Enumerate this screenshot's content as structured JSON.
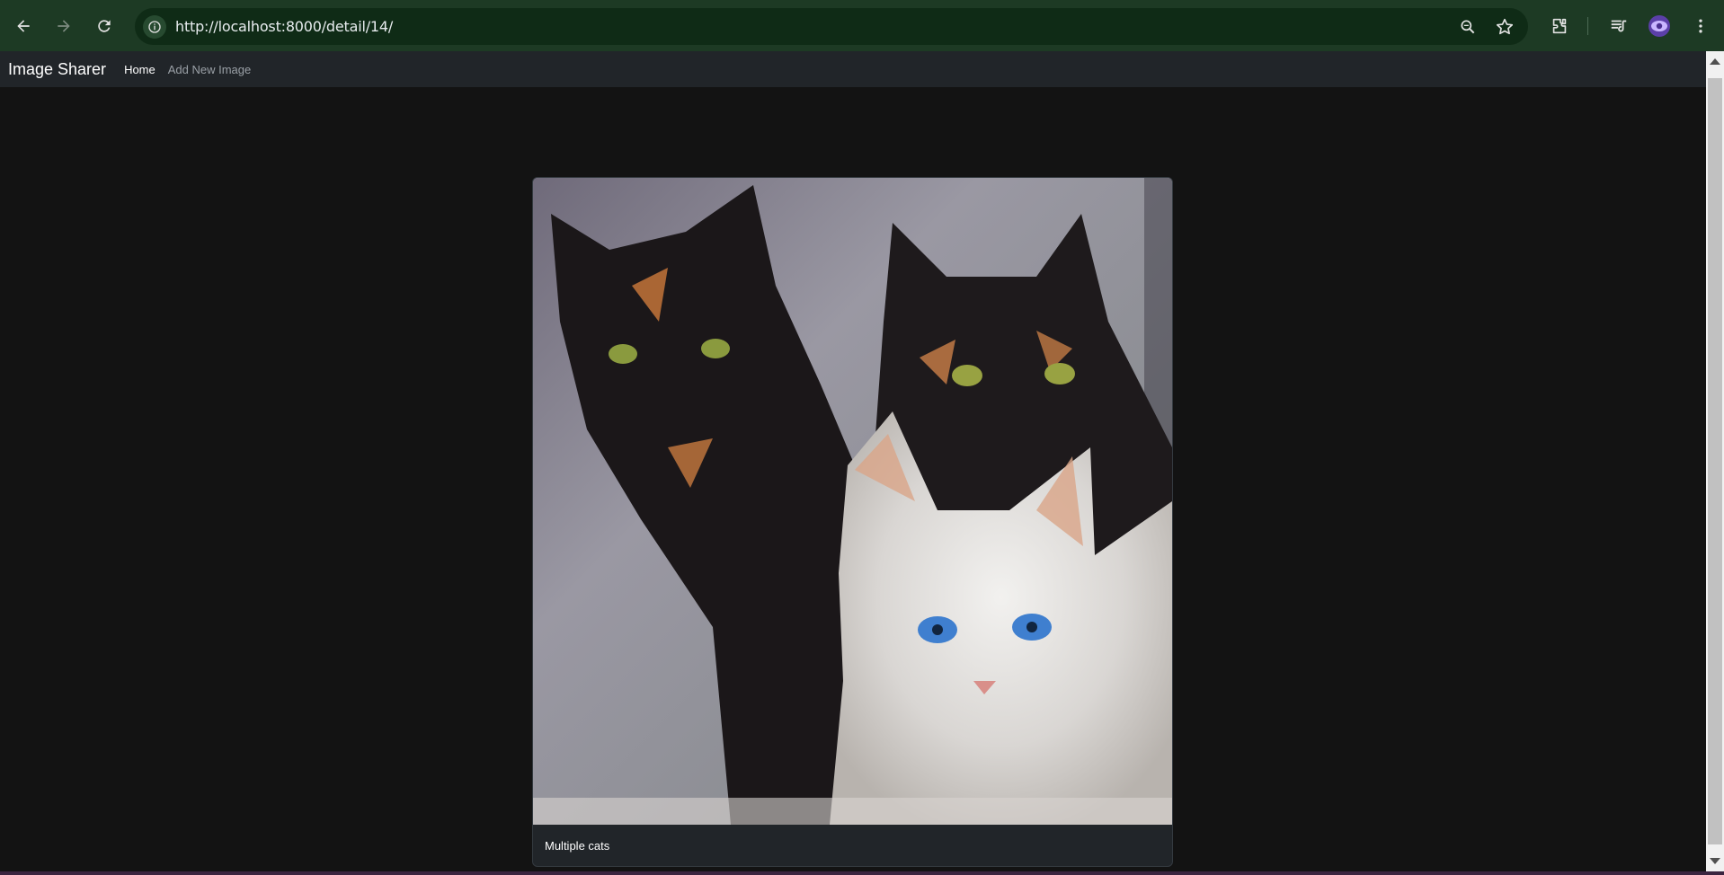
{
  "browser": {
    "url": "http://localhost:8000/detail/14/",
    "icons": [
      "back-icon",
      "forward-icon",
      "reload-icon",
      "site-info-icon",
      "zoom-icon",
      "bookmark-star-icon",
      "extensions-icon",
      "reading-list-icon",
      "profile-avatar-icon",
      "menu-kebab-icon"
    ]
  },
  "site": {
    "brand": "Image Sharer",
    "nav": {
      "home": "Home",
      "add_new": "Add New Image"
    }
  },
  "image_card": {
    "caption": "Multiple cats"
  },
  "colors": {
    "browser_frame": "#1d3a24",
    "omnibox": "#0f2b16",
    "page_bg": "#131313",
    "navbar_bg": "#212529",
    "card_bg": "#212529"
  }
}
